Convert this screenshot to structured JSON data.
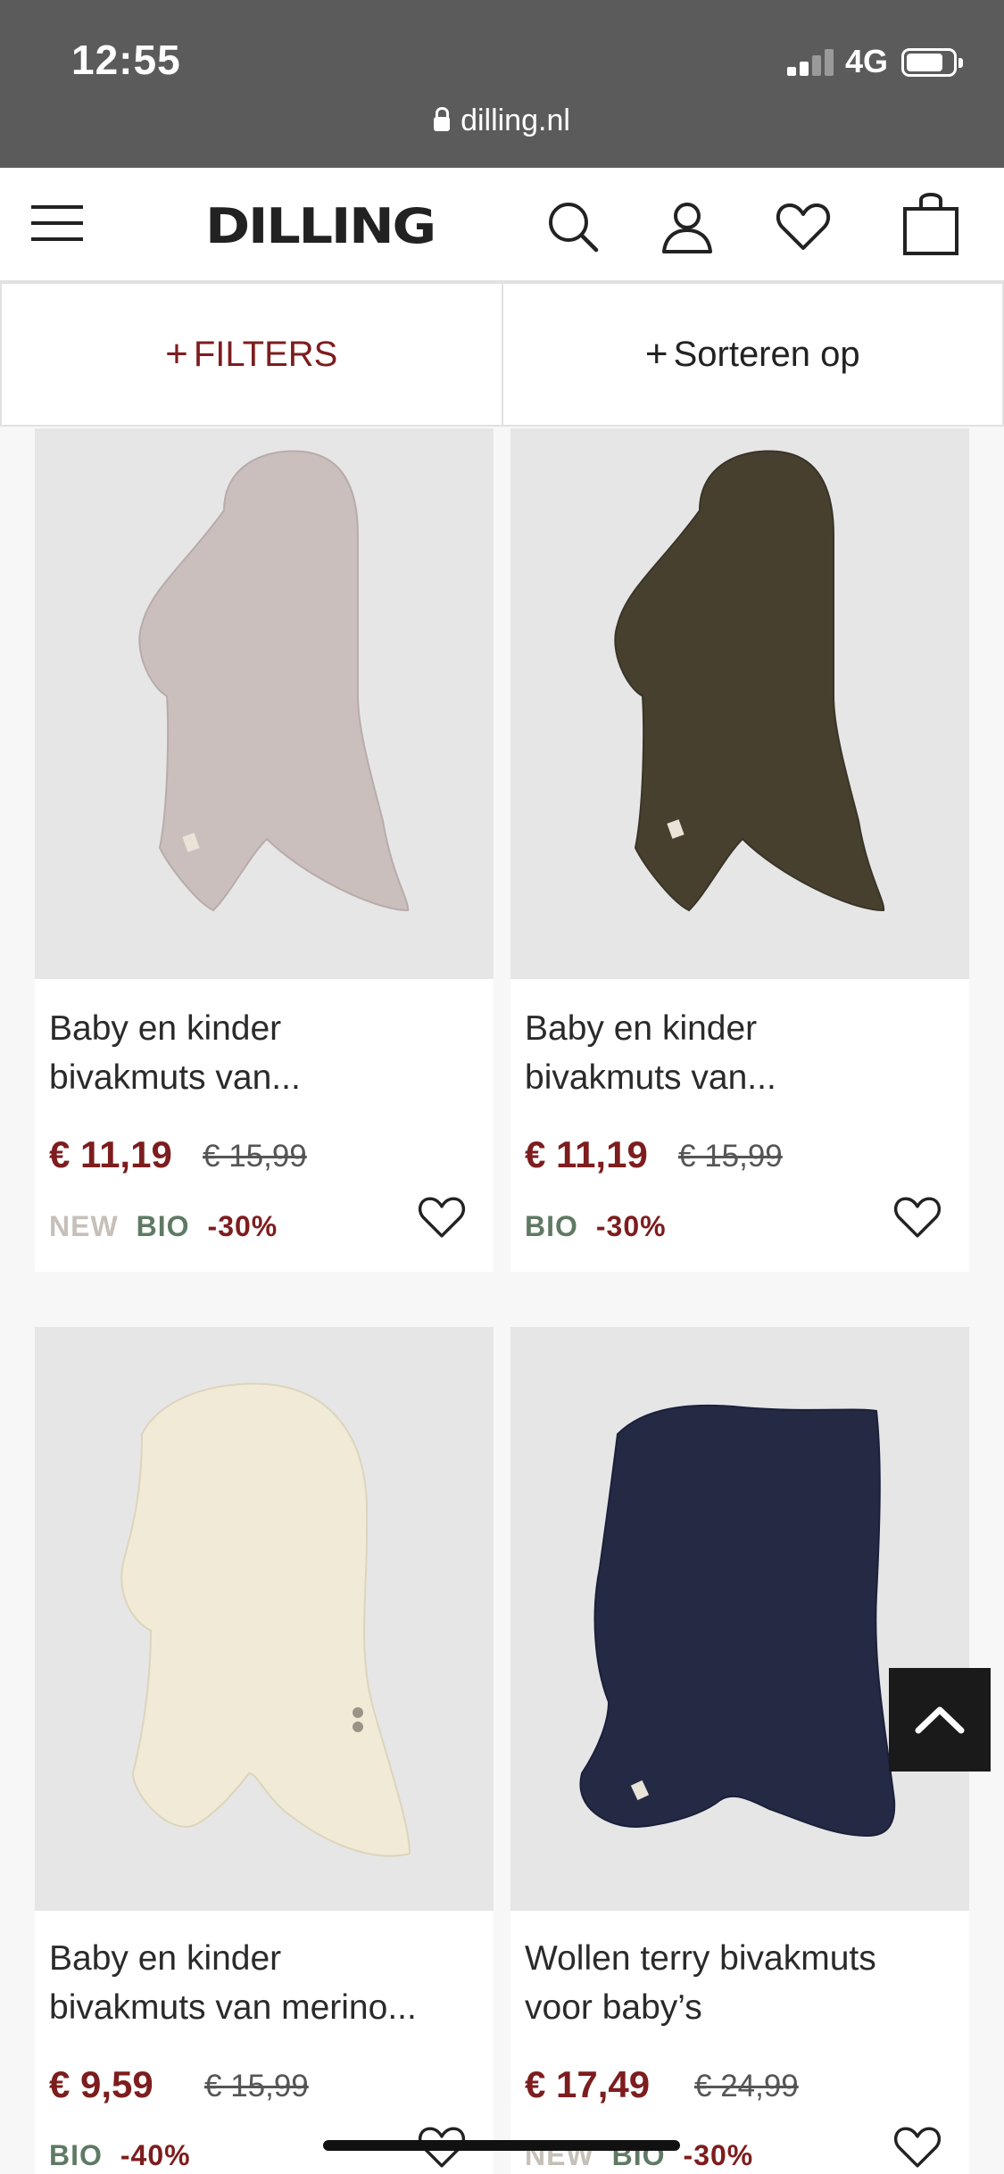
{
  "status": {
    "time": "12:55",
    "network": "4G",
    "battery_level": 0.8,
    "signal_bars": 4,
    "signal_active": 2
  },
  "browser": {
    "url": "dilling.nl"
  },
  "header": {
    "logo": "DILLING",
    "icons": [
      "menu-icon",
      "search-icon",
      "account-icon",
      "heart-icon",
      "bag-icon"
    ]
  },
  "filterbar": {
    "filters_label": "FILTERS",
    "sort_label": "Sorteren op"
  },
  "products": [
    {
      "title_line1": "Baby en kinder",
      "title_line2": "bivakmuts van...",
      "price": "€ 11,19",
      "old_price": "€ 15,99",
      "tag_new": "NEW",
      "tag_bio": "BIO",
      "discount": "-30%",
      "color": "#cbbfbe"
    },
    {
      "title_line1": "Baby en kinder",
      "title_line2": "bivakmuts van...",
      "price": "€ 11,19",
      "old_price": "€ 15,99",
      "tag_new": "",
      "tag_bio": "BIO",
      "discount": "-30%",
      "color": "#47402f"
    },
    {
      "title_line1": "Baby en kinder",
      "title_line2": "bivakmuts van merino...",
      "price": "€ 9,59",
      "old_price": "€ 15,99",
      "tag_new": "",
      "tag_bio": "BIO",
      "discount": "-40%",
      "color": "#f1ead6"
    },
    {
      "title_line1": "Wollen terry bivakmuts",
      "title_line2": "voor baby’s",
      "price": "€ 17,49",
      "old_price": "€ 24,99",
      "tag_new": "NEW",
      "tag_bio": "BIO",
      "discount": "-30%",
      "color": "#242a44"
    }
  ],
  "colors": {
    "accent": "#7d1d1e",
    "bio": "#5f7a64",
    "new": "#c6c0b9"
  }
}
